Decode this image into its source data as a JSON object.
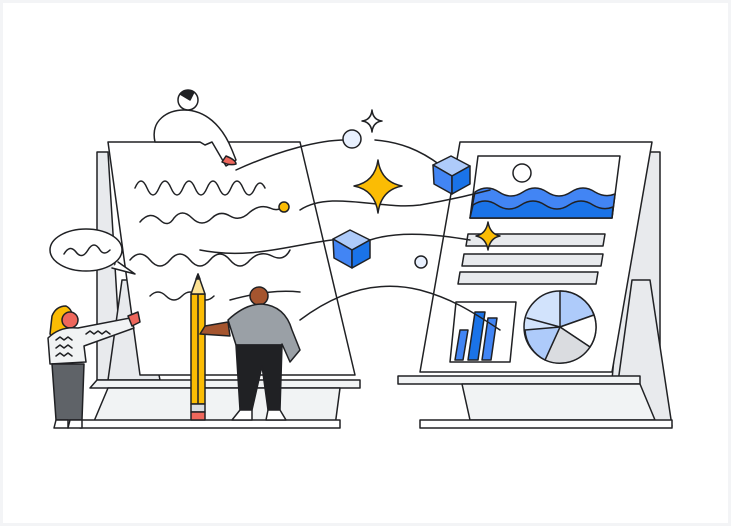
{
  "illustration": {
    "palette": {
      "outline": "#202124",
      "blue": "#4285f4",
      "blue_light": "#aecbfa",
      "blue_pale": "#d2e3fc",
      "yellow": "#fbbc04",
      "orange": "#e37400",
      "skin_dark": "#a5552f",
      "gray_shirt": "#9aa0a6",
      "panel_fill": "#f1f3f4",
      "red": "#ee675c"
    },
    "elements": [
      "left-easel",
      "right-easel",
      "scribble-lines",
      "sparkles",
      "cubes",
      "wave-image",
      "bar-chart",
      "pie-chart",
      "pencil",
      "people"
    ]
  }
}
